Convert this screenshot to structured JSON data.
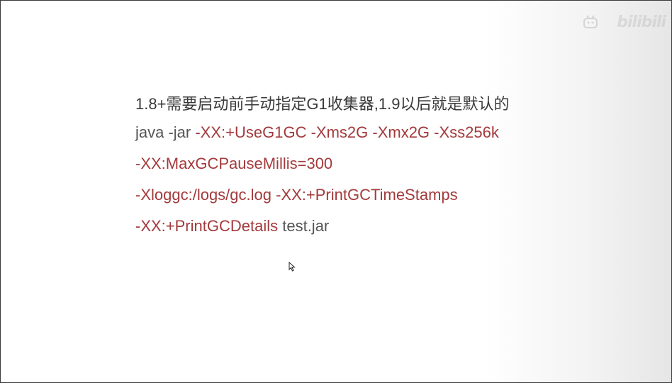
{
  "watermark": {
    "text": "bilibili",
    "icon": "bilibili-logo-icon"
  },
  "slide": {
    "title": "1.8+需要启动前手动指定G1收集器,1.9以后就是默认的",
    "line1": {
      "prefix": "java -jar ",
      "options": "-XX:+UseG1GC -Xms2G -Xmx2G -Xss256k"
    },
    "line2": {
      "options": "-XX:MaxGCPauseMillis=300"
    },
    "line3": {
      "options": "-Xloggc:/logs/gc.log -XX:+PrintGCTimeStamps"
    },
    "line4": {
      "options": "-XX:+PrintGCDetails",
      "suffix": " test.jar"
    }
  },
  "colors": {
    "option_red": "#a33a3c",
    "command_gray": "#555555",
    "title_dark": "#3a3a3a"
  },
  "cursor": {
    "icon": "mouse-pointer-icon"
  }
}
